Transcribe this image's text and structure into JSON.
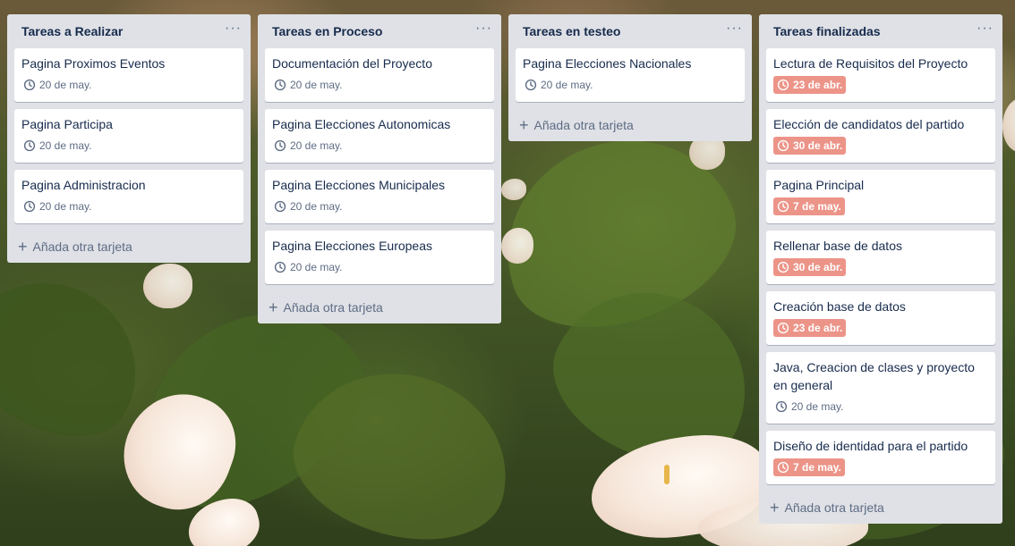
{
  "board": {
    "lists": [
      {
        "title": "Tareas a Realizar",
        "menu": "···",
        "add_label": "Añada otra tarjeta",
        "cards": [
          {
            "title": "Pagina Proximos Eventos",
            "due": "20 de may.",
            "overdue": false
          },
          {
            "title": "Pagina Participa",
            "due": "20 de may.",
            "overdue": false
          },
          {
            "title": "Pagina Administracion",
            "due": "20 de may.",
            "overdue": false
          }
        ]
      },
      {
        "title": "Tareas en Proceso",
        "menu": "···",
        "add_label": "Añada otra tarjeta",
        "cards": [
          {
            "title": "Documentación del Proyecto",
            "due": "20 de may.",
            "overdue": false
          },
          {
            "title": "Pagina Elecciones Autonomicas",
            "due": "20 de may.",
            "overdue": false
          },
          {
            "title": "Pagina Elecciones Municipales",
            "due": "20 de may.",
            "overdue": false
          },
          {
            "title": "Pagina Elecciones Europeas",
            "due": "20 de may.",
            "overdue": false
          }
        ]
      },
      {
        "title": "Tareas en testeo",
        "menu": "···",
        "add_label": "Añada otra tarjeta",
        "cards": [
          {
            "title": "Pagina Elecciones Nacionales",
            "due": "20 de may.",
            "overdue": false
          }
        ]
      },
      {
        "title": "Tareas finalizadas",
        "menu": "···",
        "add_label": "Añada otra tarjeta",
        "cards": [
          {
            "title": "Lectura de Requisitos del Proyecto",
            "due": "23 de abr.",
            "overdue": true
          },
          {
            "title": "Elección de candidatos del partido",
            "due": "30 de abr.",
            "overdue": true
          },
          {
            "title": "Pagina Principal",
            "due": "7 de may.",
            "overdue": true
          },
          {
            "title": "Rellenar base de datos",
            "due": "30 de abr.",
            "overdue": true
          },
          {
            "title": "Creación base de datos",
            "due": "23 de abr.",
            "overdue": true
          },
          {
            "title": "Java, Creacion de clases y proyecto en general",
            "due": "20 de may.",
            "overdue": false
          },
          {
            "title": "Diseño de identidad para el partido",
            "due": "7 de may.",
            "overdue": true
          }
        ]
      }
    ]
  },
  "icons": {
    "due": "clock-icon",
    "add": "plus-icon",
    "menu": "more-options-icon"
  },
  "colors": {
    "list_bg": "#dfe1e6",
    "card_bg": "#ffffff",
    "overdue": "#ec9488",
    "title_text": "#172b4d",
    "muted_text": "#5e6c84"
  }
}
